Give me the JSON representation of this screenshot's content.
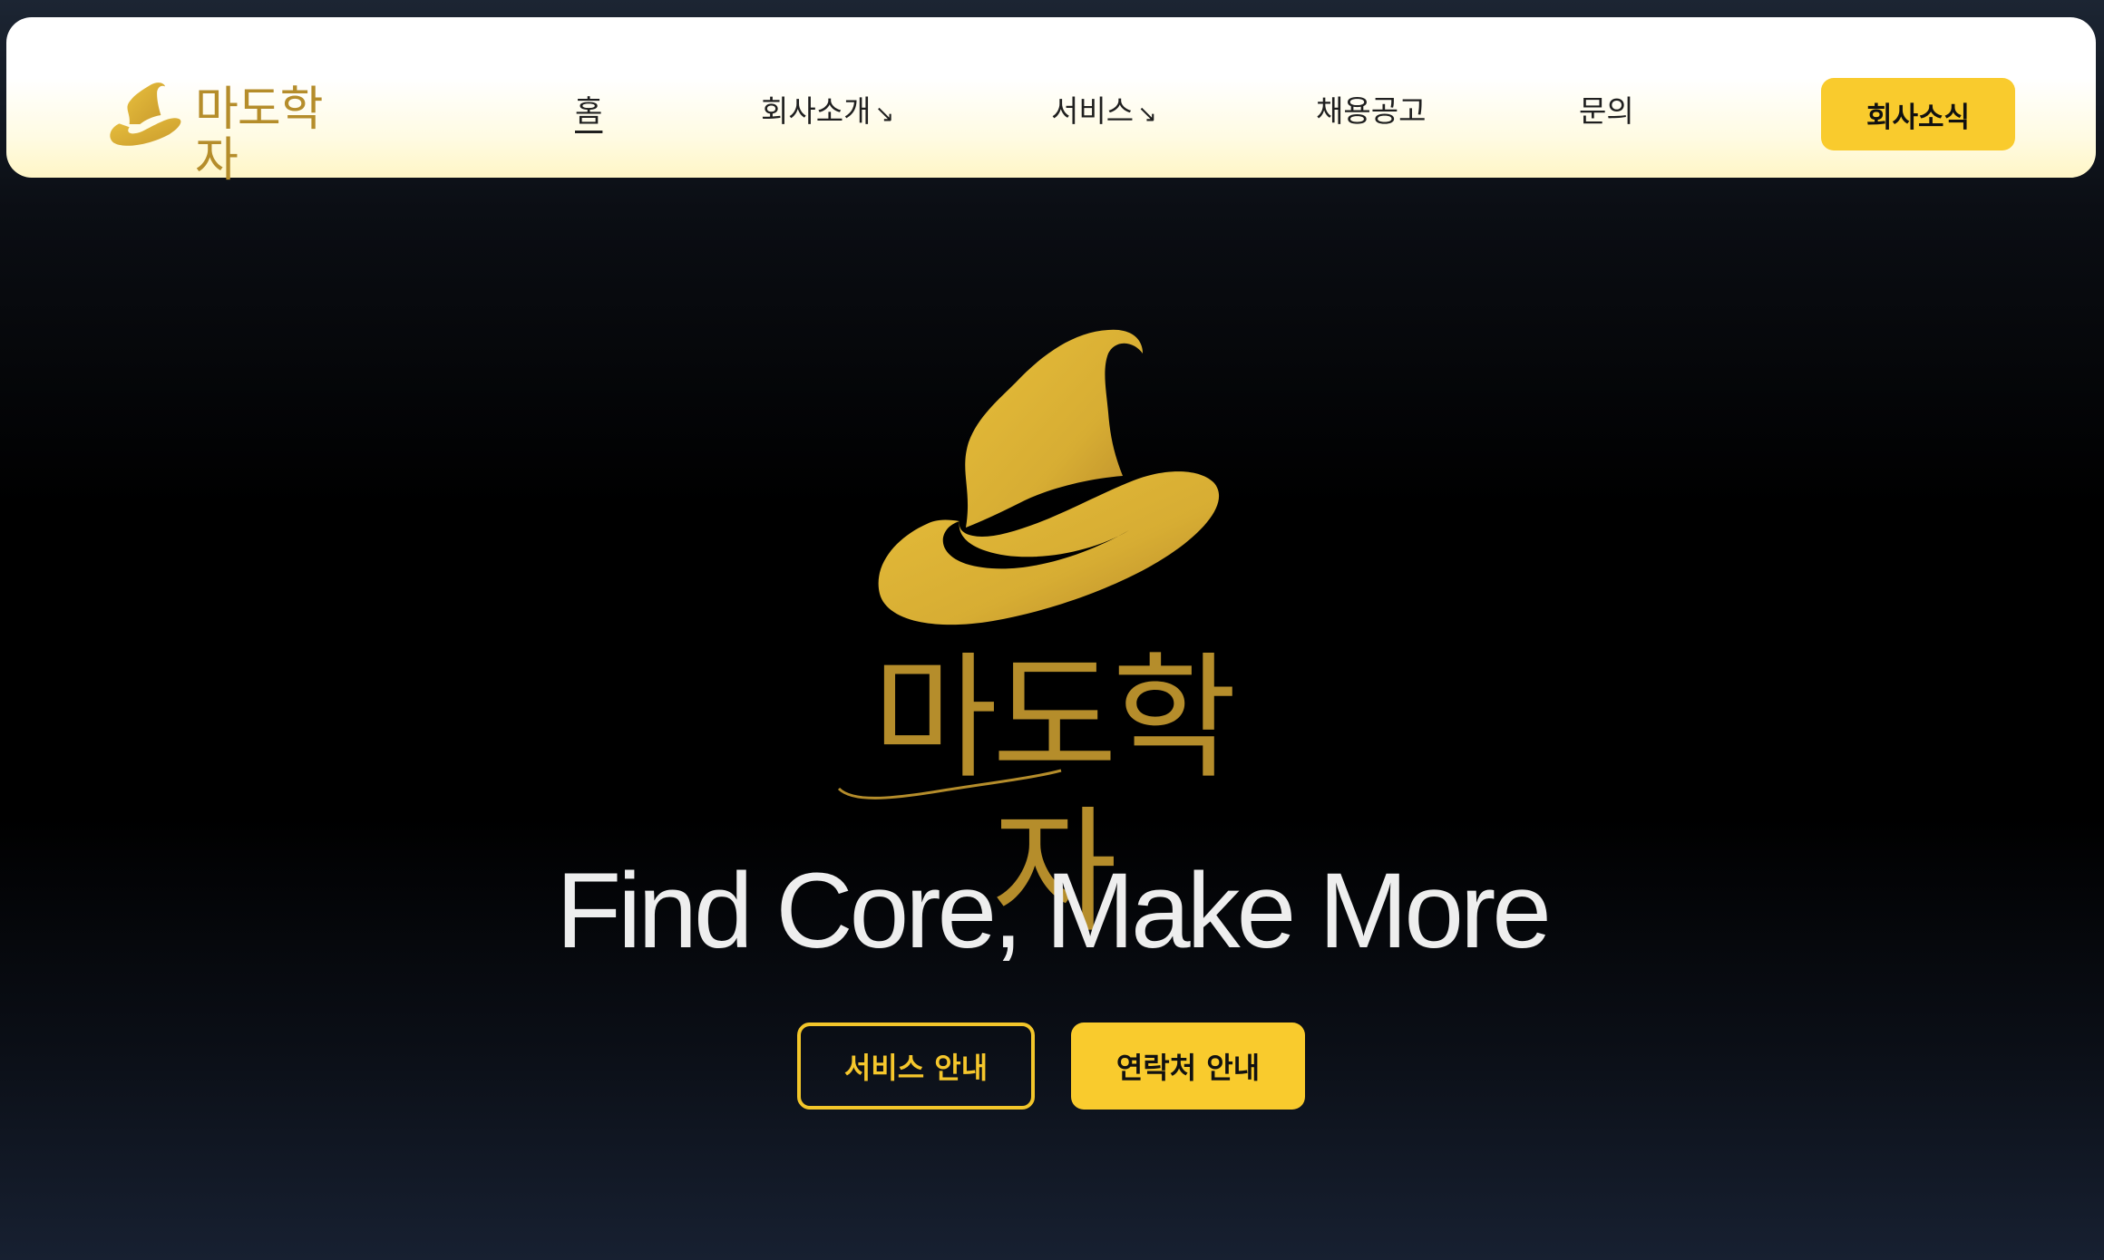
{
  "header": {
    "brand_name": "마도학자",
    "nav": [
      {
        "label": "홈"
      },
      {
        "label": "회사소개",
        "arrow": "↘"
      },
      {
        "label": "서비스",
        "arrow": "↘"
      },
      {
        "label": "채용공고"
      },
      {
        "label": "문의"
      }
    ],
    "cta_label": "회사소식"
  },
  "hero": {
    "wordmark": "마도학자",
    "tagline": "Find Core, Make More",
    "primary_button": "서비스 안내",
    "secondary_button": "연락처 안내"
  },
  "colors": {
    "accent": "#f9cb2d",
    "gold": "#d9b033",
    "wordmark": "#b58d2b",
    "background": "#000000"
  },
  "icons": {
    "logo": "wizard-hat-icon"
  }
}
